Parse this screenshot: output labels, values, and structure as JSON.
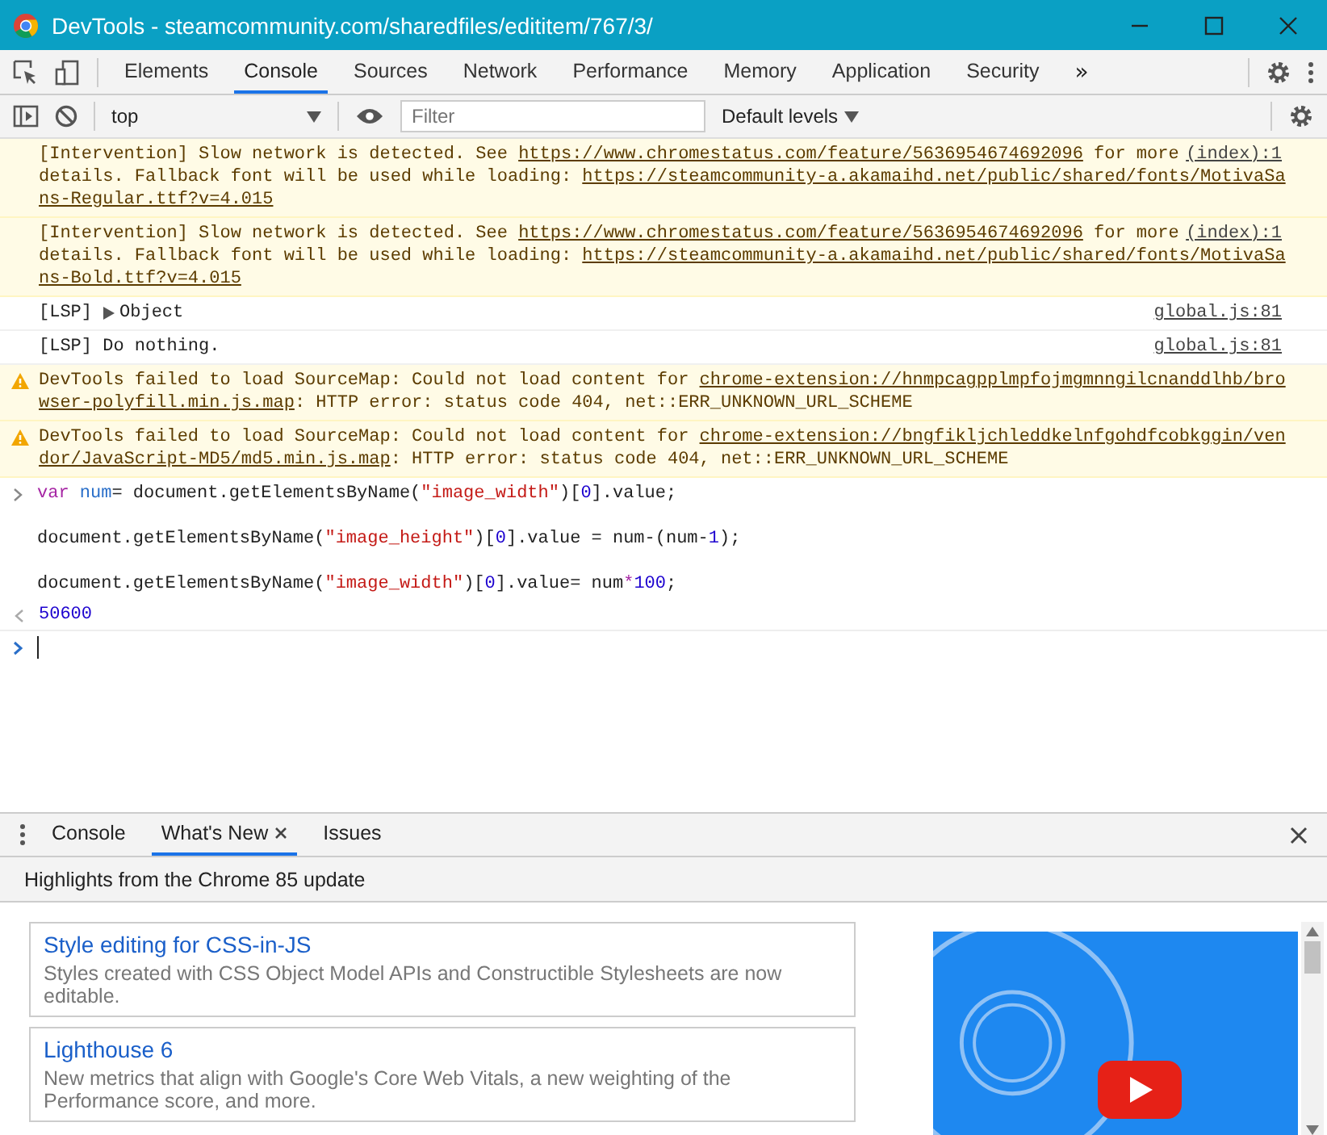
{
  "window": {
    "title": "DevTools - steamcommunity.com/sharedfiles/edititem/767/3/"
  },
  "tabs": [
    {
      "label": "Elements",
      "selected": false
    },
    {
      "label": "Console",
      "selected": true
    },
    {
      "label": "Sources",
      "selected": false
    },
    {
      "label": "Network",
      "selected": false
    },
    {
      "label": "Performance",
      "selected": false
    },
    {
      "label": "Memory",
      "selected": false
    },
    {
      "label": "Application",
      "selected": false
    },
    {
      "label": "Security",
      "selected": false
    }
  ],
  "more_tabs": "»",
  "toolbar": {
    "context": "top",
    "filter_placeholder": "Filter",
    "levels": "Default levels"
  },
  "messages": [
    {
      "kind": "intervention",
      "source": "(index):1",
      "lines": [
        [
          {
            "kind": "text",
            "text": "[Intervention] Slow network is detected. See "
          },
          {
            "kind": "link",
            "text": "https://www.chromestatus.com/feature/5636954674692096"
          },
          {
            "kind": "text",
            "text": " for more"
          }
        ],
        [
          {
            "kind": "text",
            "text": "details. Fallback font will be used while loading: "
          },
          {
            "kind": "link",
            "text": "https://steamcommunity-a.akamaihd.net/public/shared/fonts/MotivaSa"
          }
        ],
        [
          {
            "kind": "link",
            "text": "ns-Regular.ttf?v=4.015"
          }
        ]
      ]
    },
    {
      "kind": "intervention",
      "source": "(index):1",
      "lines": [
        [
          {
            "kind": "text",
            "text": "[Intervention] Slow network is detected. See "
          },
          {
            "kind": "link",
            "text": "https://www.chromestatus.com/feature/5636954674692096"
          },
          {
            "kind": "text",
            "text": " for more"
          }
        ],
        [
          {
            "kind": "text",
            "text": "details. Fallback font will be used while loading: "
          },
          {
            "kind": "link",
            "text": "https://steamcommunity-a.akamaihd.net/public/shared/fonts/MotivaSa"
          }
        ],
        [
          {
            "kind": "link",
            "text": "ns-Bold.ttf?v=4.015"
          }
        ]
      ]
    },
    {
      "kind": "log",
      "source": "global.js:81",
      "lines": [
        [
          {
            "kind": "text",
            "text": "[LSP]"
          },
          {
            "kind": "object",
            "text": "Object"
          }
        ]
      ]
    },
    {
      "kind": "log",
      "source": "global.js:81",
      "lines": [
        [
          {
            "kind": "text",
            "text": "[LSP] Do nothing."
          }
        ]
      ]
    },
    {
      "kind": "warning",
      "lines": [
        [
          {
            "kind": "text",
            "text": "DevTools failed to load SourceMap: Could not load content for "
          },
          {
            "kind": "link",
            "text": "chrome-extension://hnmpcagpplmpfojmgmnngilcnanddlhb/bro"
          }
        ],
        [
          {
            "kind": "link",
            "text": "wser-polyfill.min.js.map"
          },
          {
            "kind": "text",
            "text": ": HTTP error: status code 404, net::ERR_UNKNOWN_URL_SCHEME"
          }
        ]
      ]
    },
    {
      "kind": "warning",
      "lines": [
        [
          {
            "kind": "text",
            "text": "DevTools failed to load SourceMap: Could not load content for "
          },
          {
            "kind": "link",
            "text": "chrome-extension://bngfikljchleddkelnfgohdfcobkggin/ven"
          }
        ],
        [
          {
            "kind": "link",
            "text": "dor/JavaScript-MD5/md5.min.js.map"
          },
          {
            "kind": "text",
            "text": ": HTTP error: status code 404, net::ERR_UNKNOWN_URL_SCHEME"
          }
        ]
      ]
    }
  ],
  "input_code": [
    [
      {
        "kind": "keyword",
        "text": "var"
      },
      {
        "kind": "variable",
        "text": " num"
      },
      {
        "kind": "plain",
        "text": "= document.getElementsByName("
      },
      {
        "kind": "string",
        "text": "\"image_width\""
      },
      {
        "kind": "plain",
        "text": ")["
      },
      {
        "kind": "number",
        "text": "0"
      },
      {
        "kind": "plain",
        "text": "].value;"
      }
    ],
    [
      {
        "kind": "plain",
        "text": "document.getElementsByName("
      },
      {
        "kind": "string",
        "text": "\"image_height\""
      },
      {
        "kind": "plain",
        "text": ")["
      },
      {
        "kind": "number",
        "text": "0"
      },
      {
        "kind": "plain",
        "text": "].value = num-(num-"
      },
      {
        "kind": "number",
        "text": "1"
      },
      {
        "kind": "plain",
        "text": ");"
      }
    ],
    [
      {
        "kind": "plain",
        "text": "document.getElementsByName("
      },
      {
        "kind": "string",
        "text": "\"image_width\""
      },
      {
        "kind": "plain",
        "text": ")["
      },
      {
        "kind": "number",
        "text": "0"
      },
      {
        "kind": "plain",
        "text": "].value= num"
      },
      {
        "kind": "operator",
        "text": "*"
      },
      {
        "kind": "number",
        "text": "100"
      },
      {
        "kind": "plain",
        "text": ";"
      }
    ]
  ],
  "result": "50600",
  "drawer": {
    "tabs": [
      {
        "label": "Console",
        "selected": false,
        "closable": false
      },
      {
        "label": "What's New",
        "selected": true,
        "closable": true
      },
      {
        "label": "Issues",
        "selected": false,
        "closable": false
      }
    ],
    "header": "Highlights from the Chrome 85 update",
    "cards": [
      {
        "title": "Style editing for CSS-in-JS",
        "description": "Styles created with CSS Object Model APIs and Constructible Stylesheets are now editable."
      },
      {
        "title": "Lighthouse 6",
        "description": "New metrics that align with Google's Core Web Vitals, a new weighting of the Performance score, and more."
      }
    ]
  }
}
